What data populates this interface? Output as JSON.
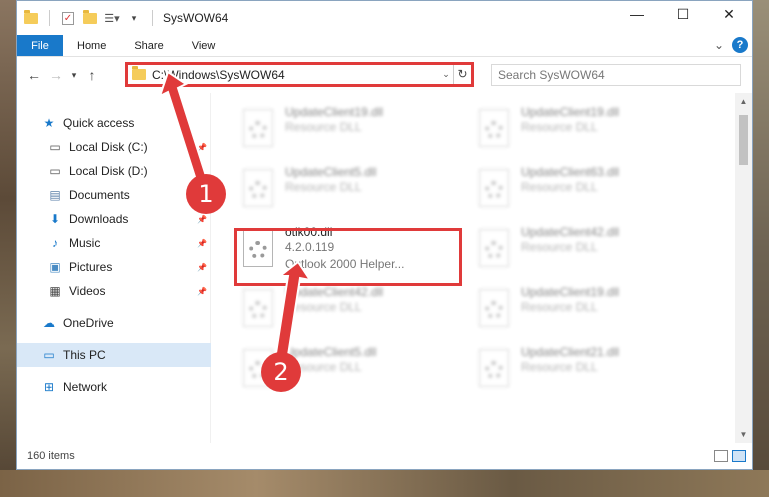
{
  "window": {
    "title": "SysWOW64",
    "controls": {
      "minimize": "—",
      "maximize": "☐",
      "close": "✕"
    }
  },
  "ribbon": {
    "tabs": [
      "File",
      "Home",
      "Share",
      "View"
    ],
    "expand": "⌄",
    "help": "?"
  },
  "address": {
    "path": "C:\\Windows\\SysWOW64",
    "search_placeholder": "Search SysWOW64"
  },
  "nav": {
    "items": [
      {
        "label": "Quick access",
        "icon": "star-icon",
        "pinned": false,
        "indent": false
      },
      {
        "label": "Local Disk (C:)",
        "icon": "drive-icon",
        "pinned": true,
        "indent": true
      },
      {
        "label": "Local Disk (D:)",
        "icon": "drive-icon",
        "pinned": false,
        "indent": true
      },
      {
        "label": "Documents",
        "icon": "documents-icon",
        "pinned": true,
        "indent": true
      },
      {
        "label": "Downloads",
        "icon": "downloads-icon",
        "pinned": true,
        "indent": true
      },
      {
        "label": "Music",
        "icon": "music-icon",
        "pinned": true,
        "indent": true
      },
      {
        "label": "Pictures",
        "icon": "pictures-icon",
        "pinned": true,
        "indent": true
      },
      {
        "label": "Videos",
        "icon": "videos-icon",
        "pinned": true,
        "indent": true
      },
      {
        "label": "OneDrive",
        "icon": "cloud-icon",
        "pinned": false,
        "indent": false
      },
      {
        "label": "This PC",
        "icon": "computer-icon",
        "pinned": false,
        "indent": false
      },
      {
        "label": "Network",
        "icon": "network-icon",
        "pinned": false,
        "indent": false
      }
    ]
  },
  "files": {
    "left": [
      {
        "name": "UpdateClient19.dll",
        "type": "Resource DLL"
      },
      {
        "name": "UpdateClient5.dll",
        "type": "Resource DLL"
      },
      {
        "name": "otlk00.dll",
        "version": "4.2.0.119",
        "description": "Outlook 2000 Helper..."
      },
      {
        "name": "UpdateClient42.dll",
        "type": "Resource DLL"
      },
      {
        "name": "UpdateClient5.dll",
        "type": "Resource DLL"
      }
    ],
    "right": [
      {
        "name": "UpdateClient19.dll",
        "type": "Resource DLL"
      },
      {
        "name": "UpdateClient63.dll",
        "type": "Resource DLL"
      },
      {
        "name": "UpdateClient42.dll",
        "type": "Resource DLL"
      },
      {
        "name": "UpdateClient19.dll",
        "type": "Resource DLL"
      },
      {
        "name": "UpdateClient21.dll",
        "type": "Resource DLL"
      }
    ]
  },
  "status": {
    "count": "160 items"
  },
  "annotations": {
    "step1": "1",
    "step2": "2",
    "color": "#e03a3a"
  }
}
